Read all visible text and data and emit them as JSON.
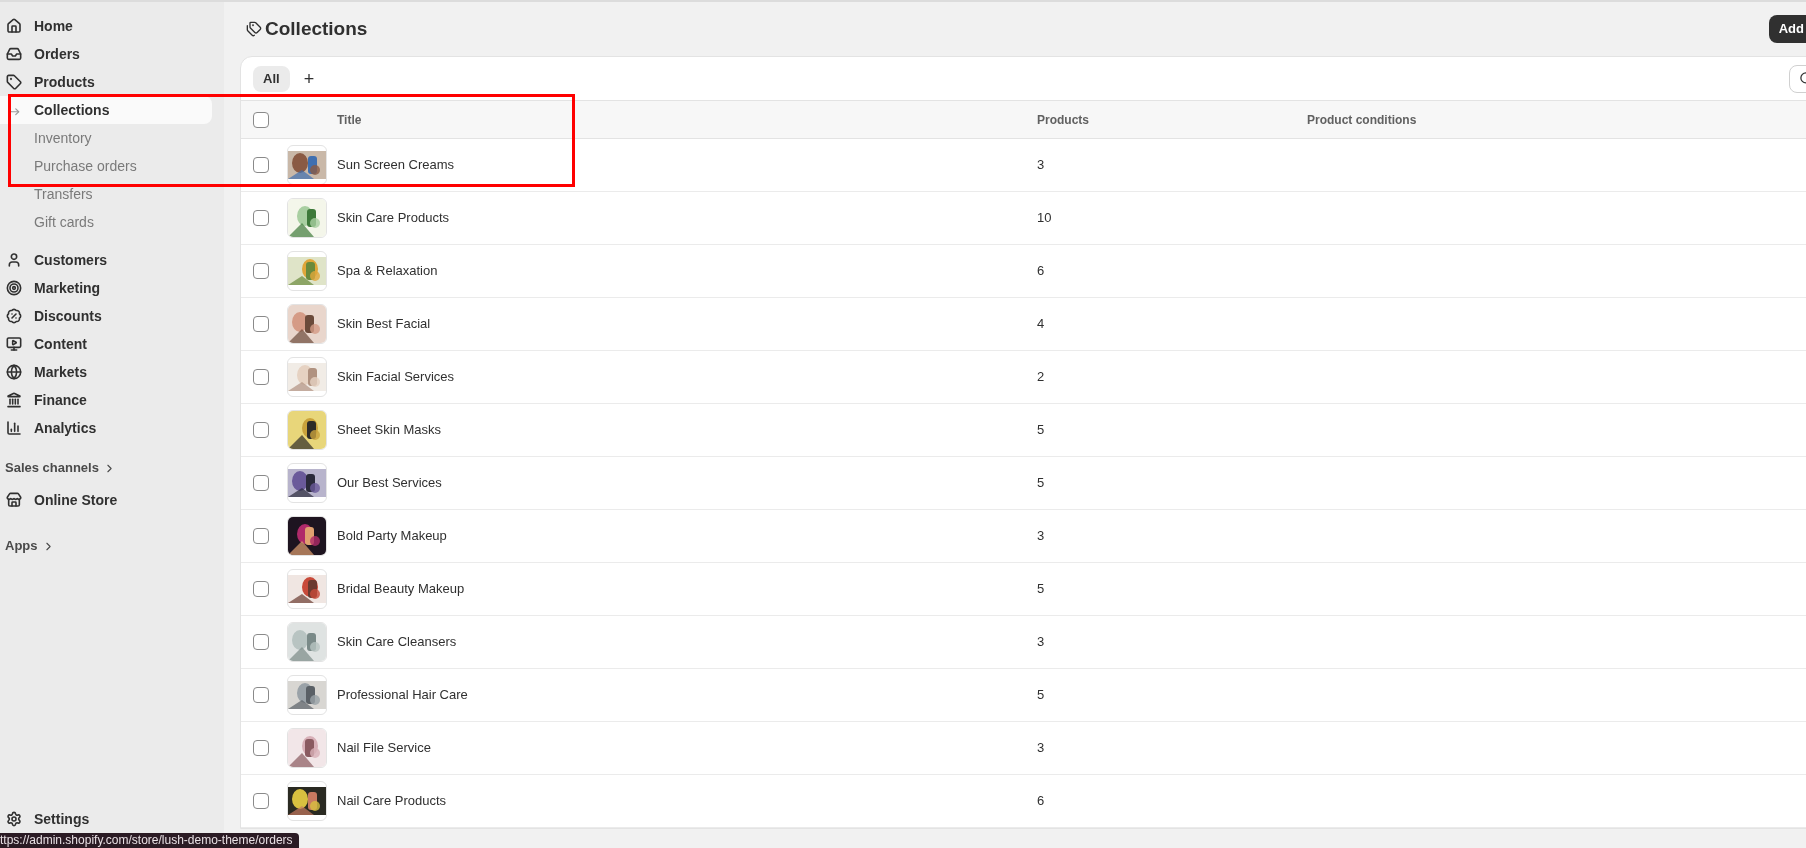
{
  "sidebar": {
    "items": [
      {
        "label": "Home",
        "kind": "main",
        "selected": false
      },
      {
        "label": "Orders",
        "kind": "main",
        "selected": false
      },
      {
        "label": "Products",
        "kind": "main",
        "selected": false
      },
      {
        "label": "Collections",
        "kind": "sub",
        "selected": true
      },
      {
        "label": "Inventory",
        "kind": "sub",
        "selected": false
      },
      {
        "label": "Purchase orders",
        "kind": "sub",
        "selected": false
      },
      {
        "label": "Transfers",
        "kind": "sub",
        "selected": false
      },
      {
        "label": "Gift cards",
        "kind": "sub",
        "selected": false
      },
      {
        "label": "Customers",
        "kind": "main",
        "selected": false
      },
      {
        "label": "Marketing",
        "kind": "main",
        "selected": false
      },
      {
        "label": "Discounts",
        "kind": "main",
        "selected": false
      },
      {
        "label": "Content",
        "kind": "main",
        "selected": false
      },
      {
        "label": "Markets",
        "kind": "main",
        "selected": false
      },
      {
        "label": "Finance",
        "kind": "main",
        "selected": false
      },
      {
        "label": "Analytics",
        "kind": "main",
        "selected": false
      },
      {
        "label": "Sales channels",
        "kind": "section"
      },
      {
        "label": "Online Store",
        "kind": "main",
        "selected": false
      },
      {
        "label": "Apps",
        "kind": "section"
      }
    ],
    "settings": "Settings"
  },
  "page": {
    "title": "Collections",
    "add_button": "Add"
  },
  "tabs": [
    {
      "label": "All",
      "kind": "view",
      "selected": true
    },
    {
      "label": "+",
      "kind": "add",
      "selected": false
    }
  ],
  "table": {
    "columns": [
      "Title",
      "Products",
      "Product conditions"
    ],
    "header_checked": false,
    "rows": [
      {
        "title": "Sun Screen Creams",
        "products": "3",
        "checked": false
      },
      {
        "title": "Skin Care Products",
        "products": "10",
        "checked": false
      },
      {
        "title": "Spa & Relaxation",
        "products": "6",
        "checked": false
      },
      {
        "title": "Skin Best Facial",
        "products": "4",
        "checked": false
      },
      {
        "title": "Skin Facial Services",
        "products": "2",
        "checked": false
      },
      {
        "title": "Sheet Skin Masks",
        "products": "5",
        "checked": false
      },
      {
        "title": "Our Best Services",
        "products": "5",
        "checked": false
      },
      {
        "title": "Bold Party Makeup",
        "products": "3",
        "checked": false
      },
      {
        "title": "Bridal Beauty Makeup",
        "products": "5",
        "checked": false
      },
      {
        "title": "Skin Care Cleansers",
        "products": "3",
        "checked": false
      },
      {
        "title": "Professional Hair Care",
        "products": "5",
        "checked": false
      },
      {
        "title": "Nail File Service",
        "products": "3",
        "checked": false
      },
      {
        "title": "Nail Care Products",
        "products": "6",
        "checked": false
      }
    ]
  },
  "highlight_box": {
    "color": "#ff0000"
  },
  "status_url": "ttps://admin.shopify.com/store/lush-demo-theme/orders"
}
